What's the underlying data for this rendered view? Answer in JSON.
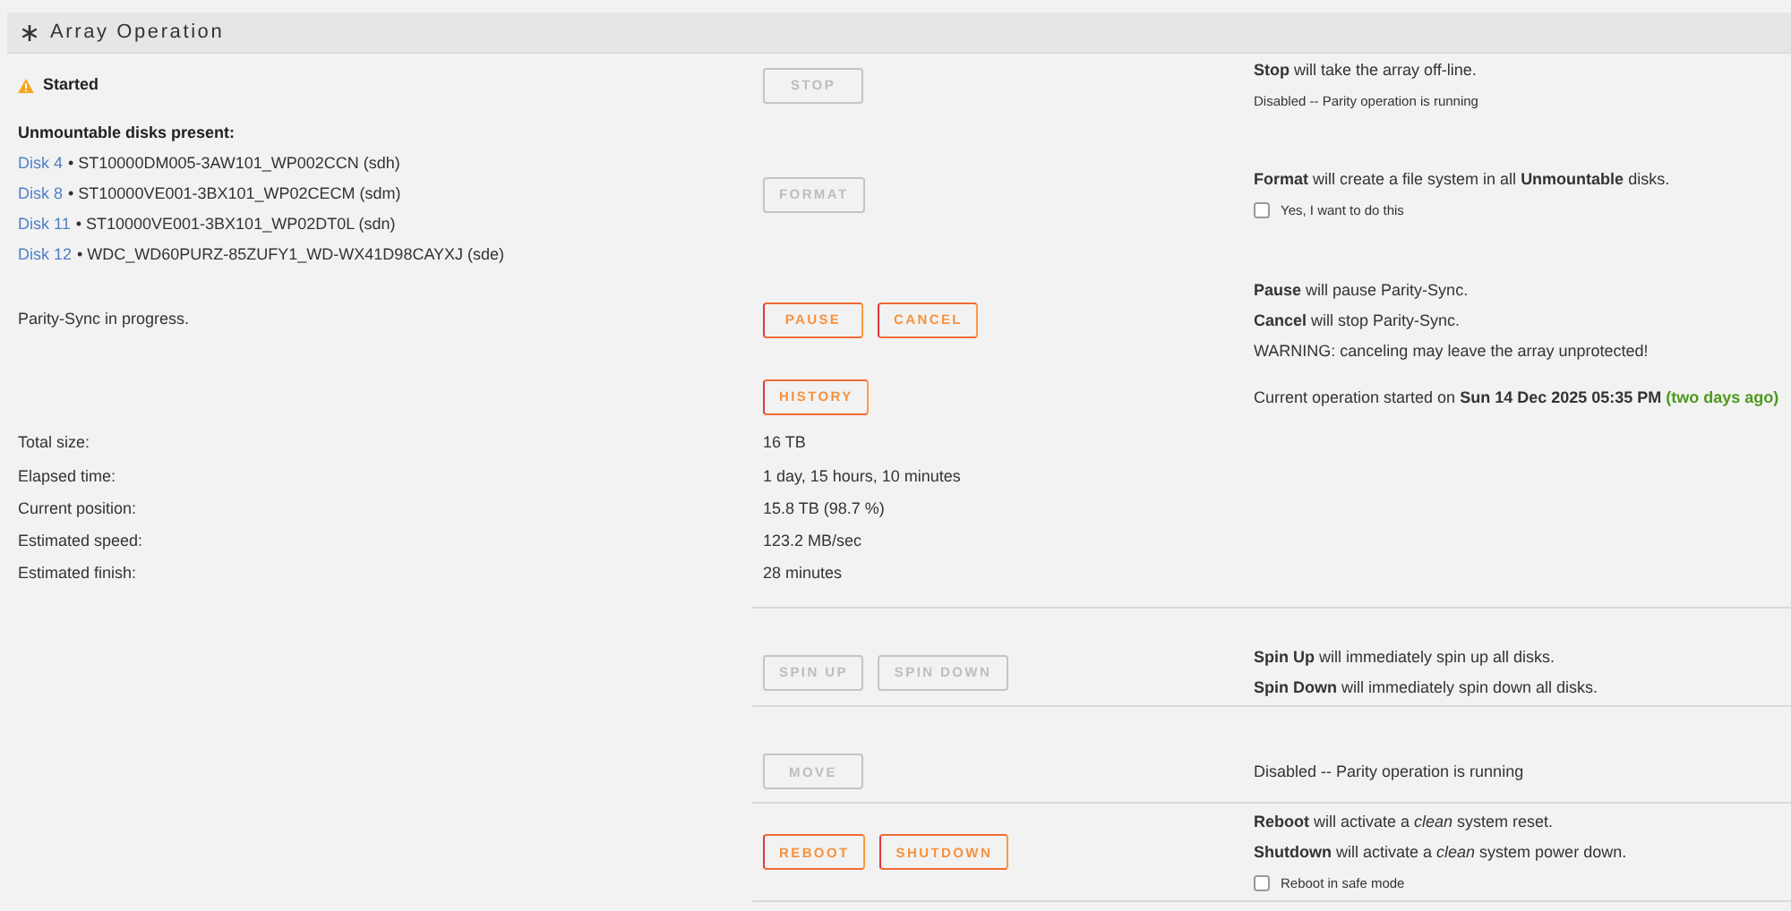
{
  "header": {
    "title": "Array Operation"
  },
  "status": {
    "label": "Started"
  },
  "unmountable": {
    "title": "Unmountable disks present:",
    "disks": [
      {
        "link": "Disk 4",
        "detail": "• ST10000DM005-3AW101_WP002CCN (sdh)"
      },
      {
        "link": "Disk 8",
        "detail": "• ST10000VE001-3BX101_WP02CECM (sdm)"
      },
      {
        "link": "Disk 11",
        "detail": "• ST10000VE001-3BX101_WP02DT0L (sdn)"
      },
      {
        "link": "Disk 12",
        "detail": "• WDC_WD60PURZ-85ZUFY1_WD-WX41D98CAYXJ (sde)"
      }
    ]
  },
  "progress_note": "Parity-Sync in progress.",
  "top_operations": [
    {
      "buttons": [
        {
          "label": "STOP",
          "disabled": true
        }
      ],
      "notes": [
        {
          "kind": "text",
          "text": "**Stop** will take the array off-line."
        },
        {
          "kind": "small",
          "text": "Disabled -- Parity operation is running"
        }
      ]
    },
    {
      "buttons": [
        {
          "label": "FORMAT",
          "disabled": true
        }
      ],
      "notes": [
        {
          "kind": "text",
          "text": "**Format** will create a file system in all **Unmountable** disks."
        },
        {
          "kind": "checkbox",
          "text": "Yes, I want to do this",
          "checked": false
        }
      ]
    },
    {
      "buttons": [
        {
          "label": "PAUSE",
          "disabled": false
        },
        {
          "label": "CANCEL",
          "disabled": false
        }
      ],
      "notes": [
        {
          "kind": "text",
          "text": "**Pause** will pause Parity-Sync."
        },
        {
          "kind": "text",
          "text": "**Cancel** will stop Parity-Sync."
        },
        {
          "kind": "text",
          "text": "WARNING: canceling may leave the array unprotected!"
        }
      ]
    },
    {
      "buttons": [
        {
          "label": "HISTORY",
          "disabled": false
        }
      ],
      "notes": [
        {
          "kind": "started",
          "text": "Current operation started on **Sun 14 Dec 2025 05:35 PM**",
          "relative": "(two days ago)"
        }
      ]
    }
  ],
  "stats": [
    {
      "label": "Total size:",
      "value": "16 TB"
    },
    {
      "label": "Elapsed time:",
      "value": "1 day, 15 hours, 10 minutes"
    },
    {
      "label": "Current position:",
      "value": "15.8 TB (98.7 %)"
    },
    {
      "label": "Estimated speed:",
      "value": "123.2 MB/sec"
    },
    {
      "label": "Estimated finish:",
      "value": "28 minutes"
    }
  ],
  "bottom_operations": [
    {
      "buttons": [
        {
          "label": "SPIN UP",
          "disabled": true
        },
        {
          "label": "SPIN DOWN",
          "disabled": true
        }
      ],
      "notes": [
        {
          "kind": "text",
          "text": "**Spin Up** will immediately spin up all disks."
        },
        {
          "kind": "text",
          "text": "**Spin Down** will immediately spin down all disks."
        }
      ]
    },
    {
      "buttons": [
        {
          "label": "MOVE",
          "disabled": true
        }
      ],
      "notes": [
        {
          "kind": "text",
          "text": "Disabled -- Parity operation is running"
        }
      ]
    },
    {
      "buttons": [
        {
          "label": "REBOOT",
          "disabled": false
        },
        {
          "label": "SHUTDOWN",
          "disabled": false
        }
      ],
      "notes": [
        {
          "kind": "text",
          "text": "**Reboot** will activate a *clean* system reset."
        },
        {
          "kind": "text",
          "text": "**Shutdown** will activate a *clean* system power down."
        },
        {
          "kind": "checkbox",
          "text": "Reboot in safe mode",
          "checked": false
        }
      ]
    }
  ]
}
